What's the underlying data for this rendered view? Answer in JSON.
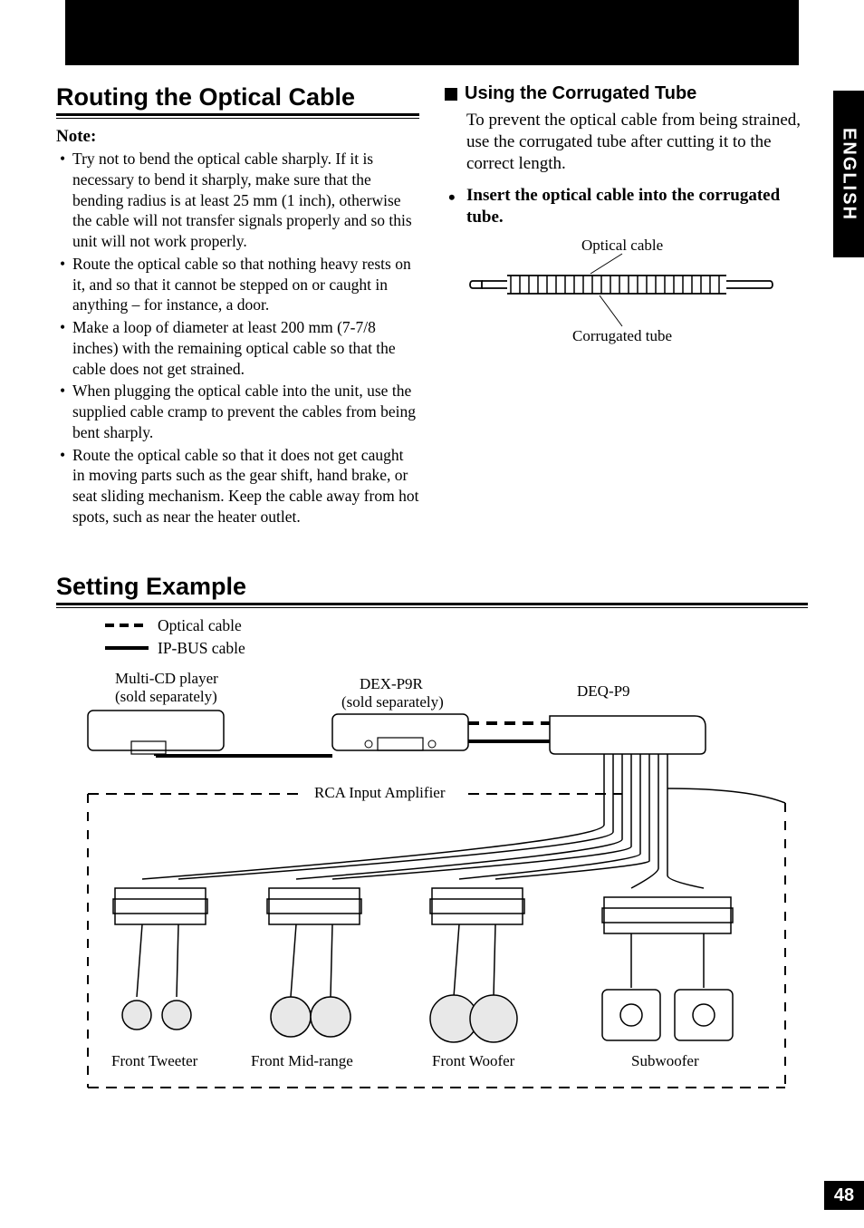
{
  "language_tab": "ENGLISH",
  "page_number": "48",
  "section1": {
    "title": "Routing the Optical Cable",
    "note_label": "Note:",
    "notes": [
      "Try not to bend the optical cable sharply. If it is necessary to bend it sharply, make sure that the bending radius is at least 25 mm (1 inch), otherwise the cable will not transfer signals properly and so this unit will not work properly.",
      "Route the optical cable so that nothing heavy rests on it, and so that it cannot be stepped on or caught in anything – for instance, a door.",
      "Make a loop of diameter at least 200 mm (7-7/8 inches) with the remaining optical cable so that the cable does not get strained.",
      "When plugging the optical cable into the unit, use the supplied cable cramp to prevent the cables from being bent sharply.",
      "Route the optical cable so that it does not get caught in moving parts such as the gear shift, hand brake, or seat sliding mechanism. Keep the cable away from hot spots, such as near the heater outlet."
    ]
  },
  "section2": {
    "title": "Using the Corrugated Tube",
    "body": "To prevent the optical cable from being strained, use the corrugated tube after cutting it to the correct length.",
    "instruction": "Insert the optical cable into the corrugated tube.",
    "label_optical": "Optical cable",
    "label_tube": "Corrugated tube"
  },
  "section3": {
    "title": "Setting Example",
    "legend_optical": "Optical cable",
    "legend_ipbus": "IP-BUS cable",
    "labels": {
      "multi_cd": "Multi-CD player",
      "sold_sep": "(sold separately)",
      "dex": "DEX-P9R",
      "deq": "DEQ-P9",
      "rca": "RCA Input Amplifier",
      "tweeter": "Front Tweeter",
      "mid": "Front Mid-range",
      "woofer": "Front Woofer",
      "sub": "Subwoofer"
    }
  }
}
